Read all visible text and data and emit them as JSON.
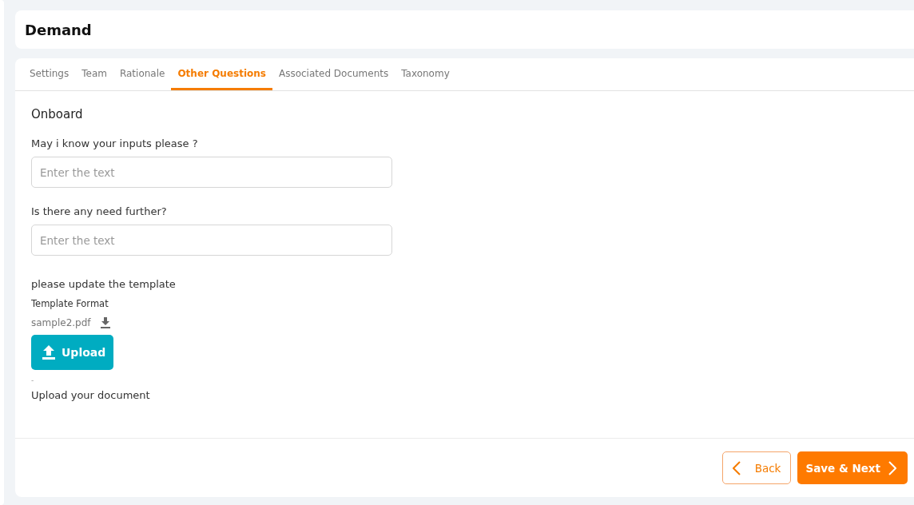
{
  "header": {
    "title": "Demand"
  },
  "tabs": [
    {
      "label": "Settings",
      "selected": false
    },
    {
      "label": "Team",
      "selected": false
    },
    {
      "label": "Rationale",
      "selected": false
    },
    {
      "label": "Other Questions",
      "selected": true
    },
    {
      "label": "Associated Documents",
      "selected": false
    },
    {
      "label": "Taxonomy",
      "selected": false
    }
  ],
  "section": {
    "title": "Onboard"
  },
  "questions": [
    {
      "label": "May i know your inputs please ?",
      "placeholder": "Enter the text"
    },
    {
      "label": "Is there any need further?",
      "placeholder": "Enter the text"
    }
  ],
  "template": {
    "label": "please update the template",
    "format_label": "Template Format",
    "file": "sample2.pdf",
    "upload_button": "Upload",
    "note": "-"
  },
  "upload_document": {
    "label": "Upload your document"
  },
  "footer": {
    "back_button": "Back",
    "next_button": "Save & Next"
  }
}
